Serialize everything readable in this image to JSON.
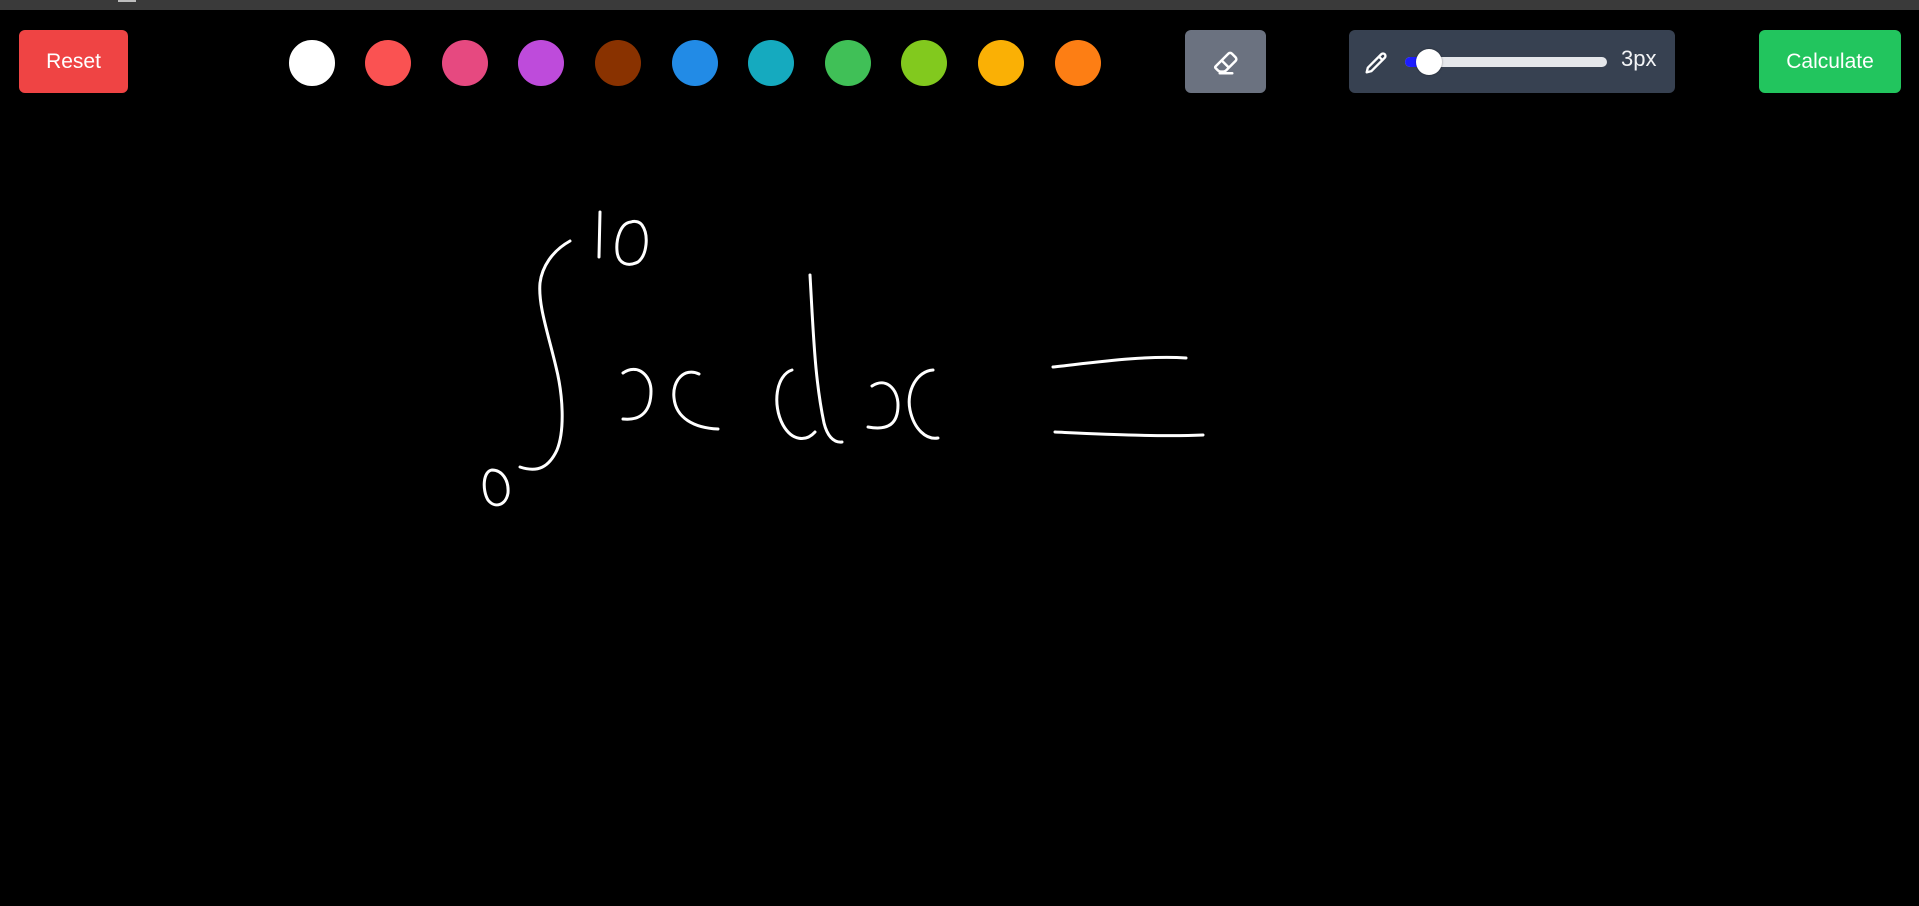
{
  "toolbar": {
    "reset_label": "Reset",
    "calculate_label": "Calculate",
    "swatches": [
      {
        "name": "black",
        "color": "#000000",
        "outlined": false
      },
      {
        "name": "white",
        "color": "#ffffff",
        "outlined": true
      },
      {
        "name": "red",
        "color": "#fa5252"
      },
      {
        "name": "pink",
        "color": "#e64980"
      },
      {
        "name": "grape",
        "color": "#be4bdb"
      },
      {
        "name": "brown",
        "color": "#893200"
      },
      {
        "name": "blue",
        "color": "#228be6"
      },
      {
        "name": "cyan",
        "color": "#15aabf"
      },
      {
        "name": "green",
        "color": "#40c057"
      },
      {
        "name": "lime",
        "color": "#82c91e"
      },
      {
        "name": "yellow",
        "color": "#fab005"
      },
      {
        "name": "orange",
        "color": "#fd7e14"
      }
    ],
    "eraser_icon": "eraser-icon",
    "brush": {
      "icon": "pencil-icon",
      "size_label": "3px",
      "slider_fraction": 0.12
    }
  },
  "canvas": {
    "background": "#000000",
    "stroke_color": "#ffffff",
    "stroke_width": 3
  },
  "colors": {
    "reset": "#ef4444",
    "calculate": "#22c55e",
    "eraser_bg": "#6b7280",
    "brush_panel_bg": "#374151",
    "slider_fill": "#1d1dff"
  }
}
